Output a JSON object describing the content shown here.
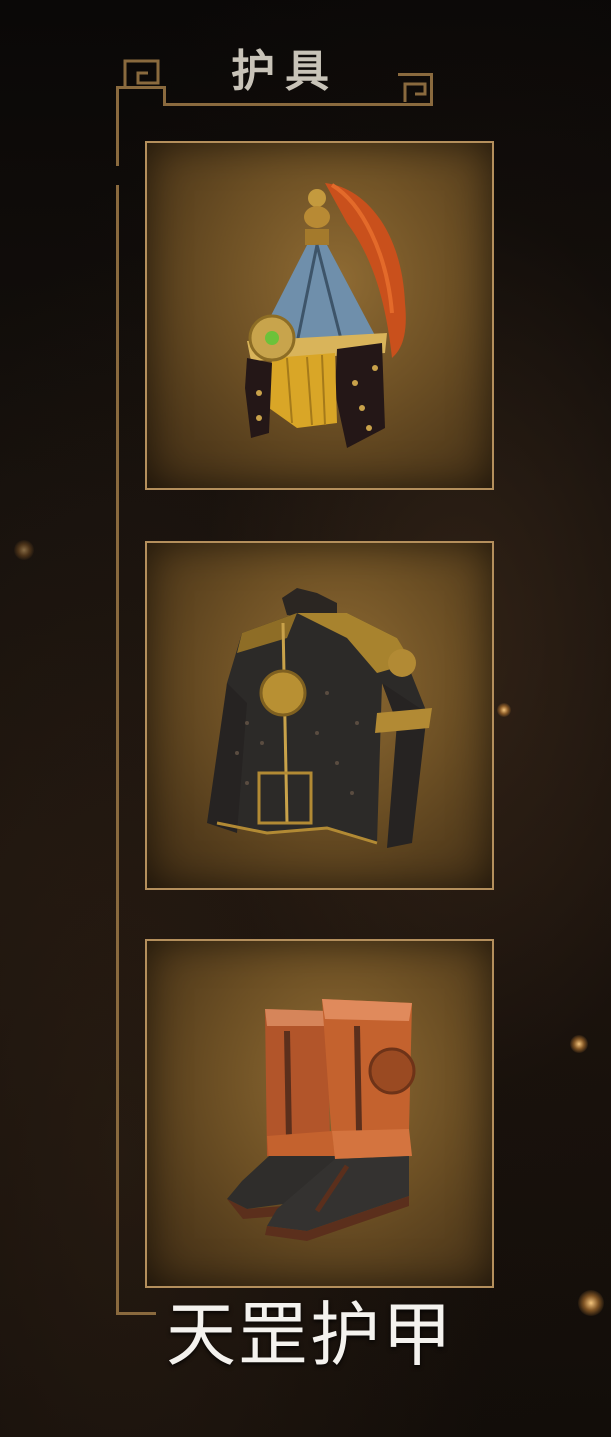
{
  "panel": {
    "title": "护具"
  },
  "slots": [
    {
      "item_icon": "helmet-icon"
    },
    {
      "item_icon": "armor-icon"
    },
    {
      "item_icon": "boots-icon"
    }
  ],
  "set_name": "天罡护甲",
  "colors": {
    "frame": "#8a6a3e",
    "slot_border": "#b48f5c",
    "slot_fill": "#6c4f24",
    "text": "#f4f2ee"
  }
}
